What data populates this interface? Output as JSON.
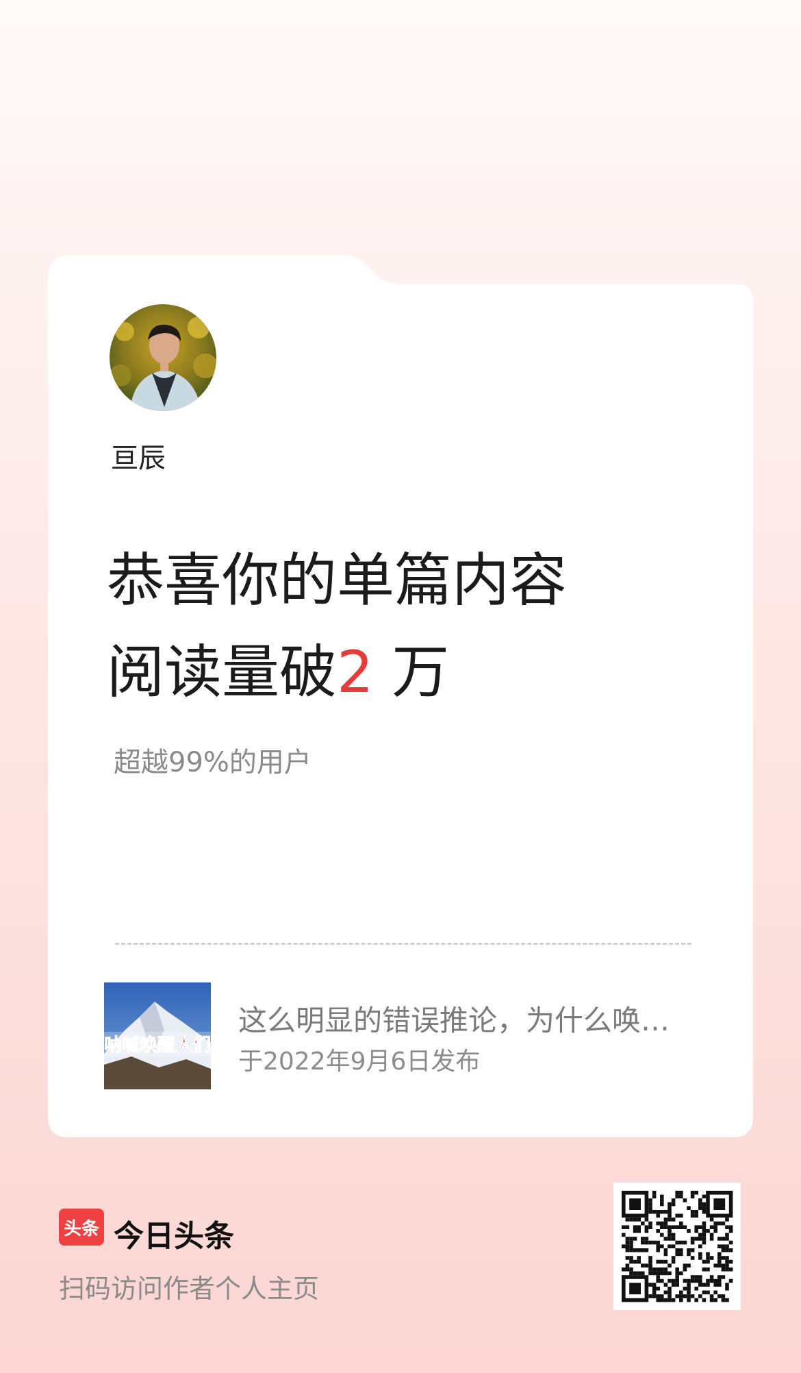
{
  "card": {
    "author_name": "亘辰",
    "headline_line1": "恭喜你的单篇内容",
    "headline_prefix": "阅读量破",
    "headline_number": "2",
    "headline_suffix": "万",
    "stat_text": "超越99%的用户"
  },
  "article": {
    "thumb_caption": "呐喊唤醒人们",
    "title": "这么明显的错误推论，为什么唤不...",
    "date": "于2022年9月6日发布"
  },
  "footer": {
    "logo_text": "头条",
    "brand_name": "今日头条",
    "caption": "扫码访问作者个人主页"
  },
  "colors": {
    "accent": "#e53b3b",
    "brand": "#f04142"
  },
  "icons": {
    "brand_logo": "toutiao-logo-icon",
    "qr": "qr-code-icon"
  }
}
